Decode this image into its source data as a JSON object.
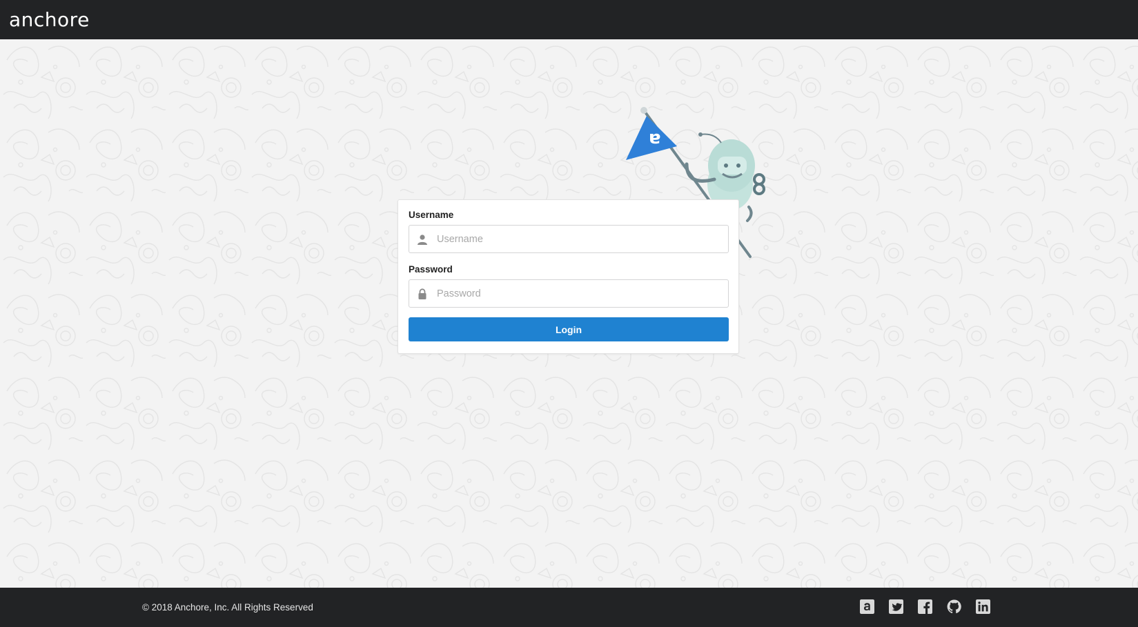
{
  "header": {
    "brand": "anchore"
  },
  "login_form": {
    "username_label": "Username",
    "username_placeholder": "Username",
    "username_value": "",
    "password_label": "Password",
    "password_placeholder": "Password",
    "password_value": "",
    "login_button": "Login",
    "username_icon": "user-icon",
    "password_icon": "lock-icon"
  },
  "footer": {
    "copyright": "© 2018 Anchore, Inc. All Rights Reserved",
    "social": [
      {
        "icon": "anchore-icon"
      },
      {
        "icon": "twitter-icon"
      },
      {
        "icon": "facebook-icon"
      },
      {
        "icon": "github-icon"
      },
      {
        "icon": "linkedin-icon"
      }
    ]
  },
  "colors": {
    "topbar": "#222325",
    "accent_button": "#1f82d1",
    "flag": "#2f80d8",
    "mascot": "#b9dcd6"
  }
}
